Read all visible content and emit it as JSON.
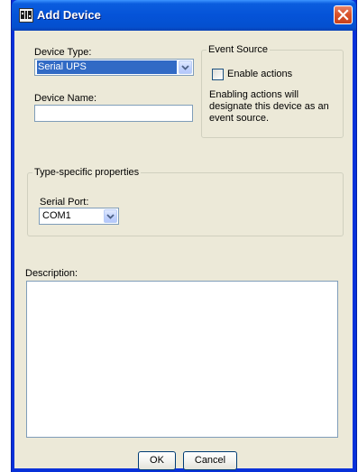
{
  "window": {
    "title": "Add Device"
  },
  "device_type": {
    "label": "Device Type:",
    "value": "Serial UPS"
  },
  "device_name": {
    "label": "Device Name:",
    "value": ""
  },
  "event_source": {
    "group_title": "Event Source",
    "checkbox_label": "Enable actions",
    "checked": false,
    "help_lines": [
      "Enabling actions will",
      "designate this device as an",
      "event source."
    ]
  },
  "type_specific": {
    "group_title": "Type-specific properties",
    "serial_port_label": "Serial Port:",
    "serial_port_value": "COM1"
  },
  "description": {
    "label": "Description:",
    "value": ""
  },
  "buttons": {
    "ok": "OK",
    "cancel": "Cancel"
  },
  "colors": {
    "title_bar": "#0553d8",
    "dialog_bg": "#ece9d8",
    "selection": "#316ac5",
    "close_button": "#d9542b"
  },
  "icons": {
    "title": "device-manager-icon",
    "close": "close-icon",
    "dropdown": "chevron-down-icon"
  }
}
